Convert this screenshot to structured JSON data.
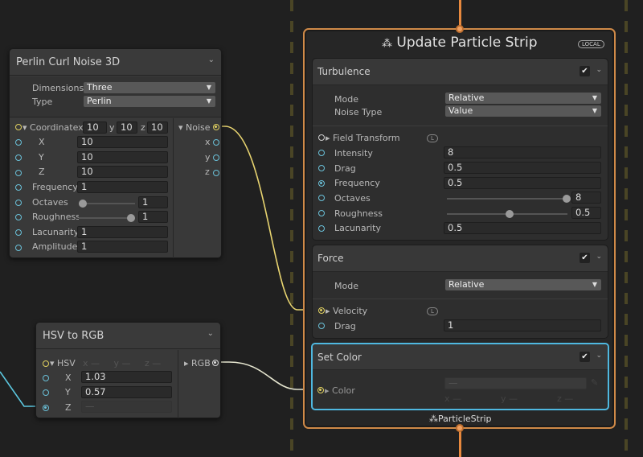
{
  "colors": {
    "background": "#202020",
    "context_border": "#d08a48",
    "selected_block": "#4fb8e0",
    "float_port": "#6ac0d8",
    "vector_port": "#e0d060"
  },
  "perlin": {
    "title": "Perlin Curl Noise 3D",
    "dimensions_label": "Dimensions",
    "dimensions_value": "Three",
    "type_label": "Type",
    "type_value": "Perlin",
    "coordinate_label": "Coordinate",
    "cx": "10",
    "cy": "10",
    "cz": "10",
    "x_lbl": "x",
    "y_lbl": "y",
    "z_lbl": "z",
    "X": "X",
    "Xv": "10",
    "Y": "Y",
    "Yv": "10",
    "Z": "Z",
    "Zv": "10",
    "frequency_label": "Frequency",
    "frequency": "1",
    "octaves_label": "Octaves",
    "octaves": "1",
    "roughness_label": "Roughness",
    "roughness": "1",
    "lacunarity_label": "Lacunarity",
    "lacunarity": "1",
    "amplitude_label": "Amplitude",
    "amplitude": "1",
    "out_label": "Noise",
    "out_x": "x",
    "out_y": "y",
    "out_z": "z",
    "octaves_slider": 0,
    "roughness_slider": 1
  },
  "hsv": {
    "title": "HSV to RGB",
    "in_label": "HSV",
    "x_lbl": "x",
    "y_lbl": "y",
    "z_lbl": "z",
    "dash": "—",
    "X": "X",
    "Xv": "1.03",
    "Y": "Y",
    "Yv": "0.57",
    "Z": "Z",
    "Zv": "—",
    "out_label": "RGB"
  },
  "context": {
    "title": "Update Particle Strip",
    "badge": "LOCAL",
    "footer": "ParticleStrip",
    "turbulence": {
      "title": "Turbulence",
      "enabled": true,
      "mode_label": "Mode",
      "mode": "Relative",
      "noise_type_label": "Noise Type",
      "noise_type": "Value",
      "field_transform_label": "Field Transform",
      "space": "L",
      "intensity_label": "Intensity",
      "intensity": "8",
      "drag_label": "Drag",
      "drag": "0.5",
      "frequency_label": "Frequency",
      "frequency": "0.5",
      "octaves_label": "Octaves",
      "octaves": "8",
      "roughness_label": "Roughness",
      "roughness": "0.5",
      "lacunarity_label": "Lacunarity",
      "lacunarity": "0.5",
      "octaves_slider": 1,
      "roughness_slider": 0.5
    },
    "force": {
      "title": "Force",
      "enabled": true,
      "mode_label": "Mode",
      "mode": "Relative",
      "velocity_label": "Velocity",
      "space": "L",
      "drag_label": "Drag",
      "drag": "1"
    },
    "set_color": {
      "title": "Set Color",
      "enabled": true,
      "color_label": "Color",
      "dash": "—",
      "x_lbl": "x",
      "y_lbl": "y",
      "z_lbl": "z"
    }
  },
  "check": "✔",
  "chevron": "⌄"
}
